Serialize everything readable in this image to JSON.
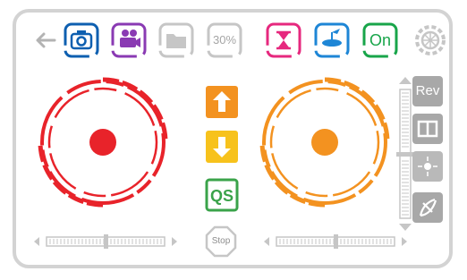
{
  "toolbar": {
    "items": [
      {
        "name": "back",
        "icon": "arrow-left-icon",
        "color": "#b3b3b3"
      },
      {
        "name": "camera",
        "icon": "camera-icon",
        "color": "#0e5fb0",
        "active": true
      },
      {
        "name": "video",
        "icon": "video-camera-icon",
        "color": "#8a3ab3",
        "active": true
      },
      {
        "name": "folder",
        "icon": "folder-icon",
        "color": "#c6c6c6",
        "active": false
      },
      {
        "name": "speed",
        "icon": "speed-icon",
        "label": "30%",
        "color": "#c6c6c6",
        "active": false
      },
      {
        "name": "hourglass",
        "icon": "hourglass-icon",
        "color": "#e6287e",
        "active": true
      },
      {
        "name": "drone",
        "icon": "propeller-icon",
        "color": "#1e86d6",
        "active": true
      },
      {
        "name": "power",
        "icon": "on-toggle-icon",
        "label": "On",
        "color": "#18a54a",
        "active": true
      },
      {
        "name": "settings",
        "icon": "gear-icon",
        "color": "#c6c6c6",
        "active": false
      }
    ]
  },
  "left_joystick": {
    "color": "#e8232a"
  },
  "right_joystick": {
    "color": "#f39220"
  },
  "center": {
    "up_button": {
      "icon": "arrow-up-icon",
      "color": "#f39220"
    },
    "down_button": {
      "icon": "arrow-down-icon",
      "color": "#f7c21c"
    },
    "loop_button": {
      "icon": "loop-icon",
      "label": "QS",
      "color": "#3aa34a"
    },
    "stop_button": {
      "label": "Stop",
      "color": "#c6c6c6"
    }
  },
  "right_panel": {
    "rev_button": {
      "label": "Rev",
      "color": "#a8a8a8"
    },
    "split_button": {
      "icon": "split-view-icon",
      "color": "#a8a8a8"
    },
    "center_button": {
      "icon": "crosshair-icon",
      "color": "#b9b9b9"
    },
    "calibrate_button": {
      "icon": "calibrate-icon",
      "color": "#a8a8a8"
    }
  },
  "trims": {
    "left_horizontal": {
      "value": 0.5
    },
    "right_horizontal": {
      "value": 0.5
    },
    "vertical": {
      "value": 0.5
    }
  }
}
